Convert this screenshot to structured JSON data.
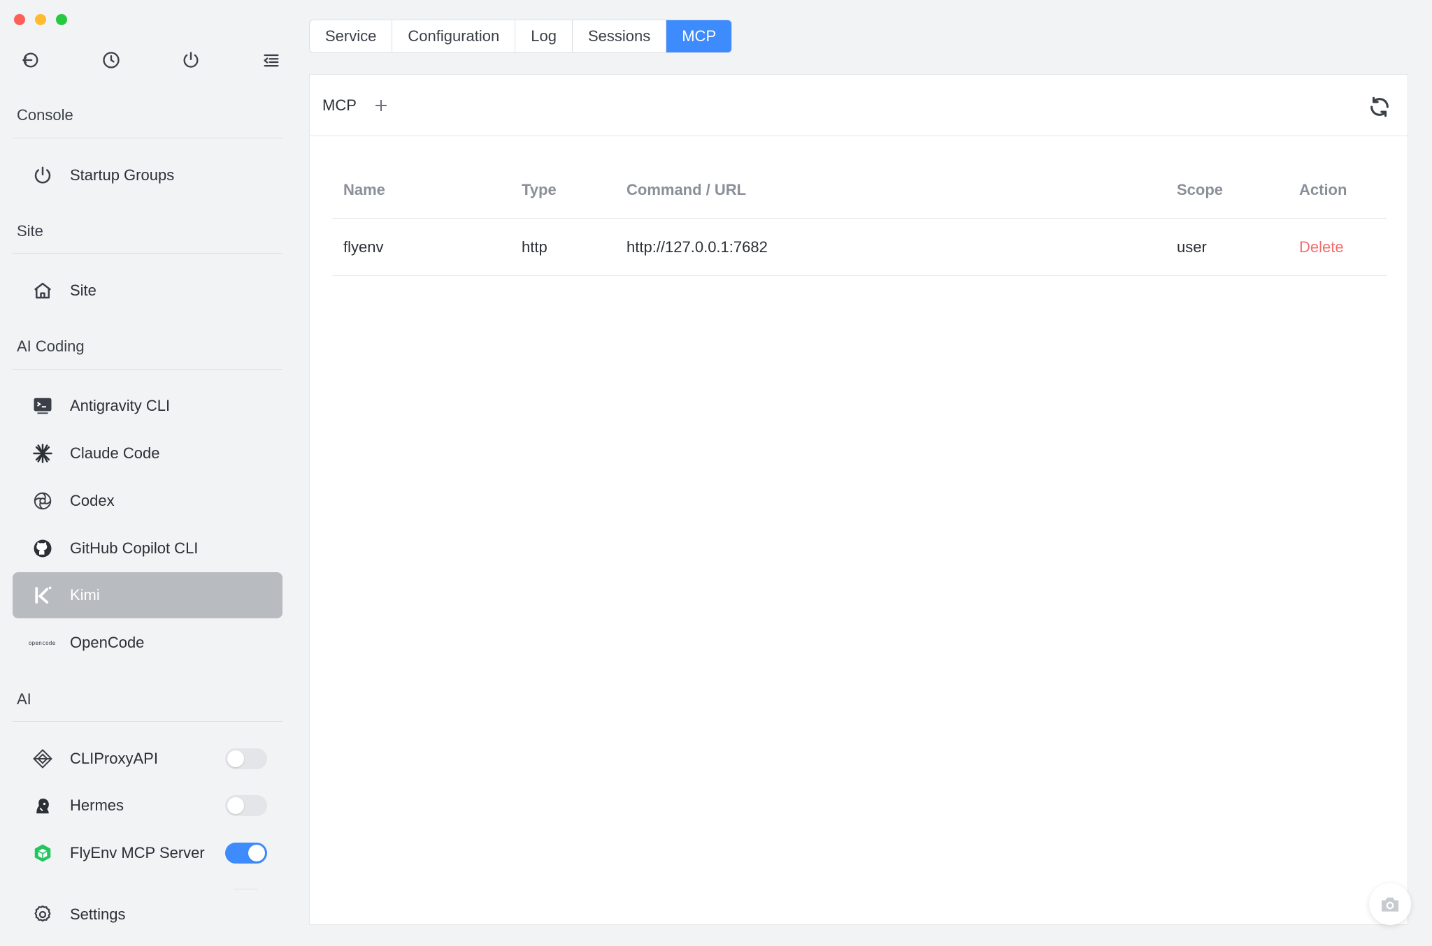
{
  "sidebar": {
    "top_icons": [
      "back-icon",
      "history-icon",
      "power-icon",
      "menu-collapse-icon"
    ],
    "sections": {
      "console": "Console",
      "site": "Site",
      "ai_coding": "AI Coding",
      "ai": "AI"
    },
    "items": {
      "startup_groups": "Startup Groups",
      "site": "Site",
      "antigravity": "Antigravity CLI",
      "claude_code": "Claude Code",
      "codex": "Codex",
      "github_copilot": "GitHub Copilot CLI",
      "kimi": "Kimi",
      "opencode": "OpenCode",
      "cliproxyapi": "CLIProxyAPI",
      "hermes": "Hermes",
      "flyenv_mcp": "FlyEnv MCP Server",
      "settings": "Settings"
    },
    "opencode_logo_text": "opencode",
    "toggles": {
      "cliproxyapi": false,
      "hermes": false,
      "flyenv_mcp": true
    },
    "active_item": "Kimi"
  },
  "tabs": [
    "Service",
    "Configuration",
    "Log",
    "Sessions",
    "MCP"
  ],
  "active_tab": "MCP",
  "panel": {
    "title": "MCP",
    "table": {
      "headers": [
        "Name",
        "Type",
        "Command / URL",
        "Scope",
        "Action"
      ],
      "rows": [
        [
          "flyenv",
          "http",
          "http://127.0.0.1:7682",
          "user",
          "Delete"
        ]
      ]
    }
  },
  "colors": {
    "accent": "#3d8bfd",
    "danger": "#f56c6c",
    "active_nav": "#b8bcc1"
  }
}
